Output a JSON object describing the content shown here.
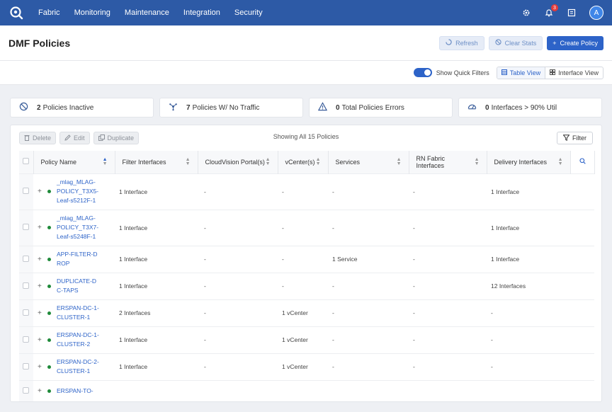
{
  "nav": {
    "items": [
      "Fabric",
      "Monitoring",
      "Maintenance",
      "Integration",
      "Security"
    ],
    "notification_count": "3",
    "avatar_initial": "A"
  },
  "header": {
    "title": "DMF Policies",
    "refresh_label": "Refresh",
    "clear_stats_label": "Clear Stats",
    "create_label": "Create Policy"
  },
  "viewbar": {
    "quick_filters_label": "Show Quick Filters",
    "table_view_label": "Table View",
    "interface_view_label": "Interface View"
  },
  "stats": [
    {
      "value": "2",
      "label": "Policies Inactive",
      "icon": "ban-icon"
    },
    {
      "value": "7",
      "label": "Policies W/ No Traffic",
      "icon": "network-icon"
    },
    {
      "value": "0",
      "label": "Total Policies Errors",
      "icon": "warning-icon"
    },
    {
      "value": "0",
      "label": "Interfaces > 90% Util",
      "icon": "gauge-icon"
    }
  ],
  "table_tools": {
    "delete_label": "Delete",
    "edit_label": "Edit",
    "duplicate_label": "Duplicate",
    "showing_text": "Showing All 15 Policies",
    "filter_label": "Filter"
  },
  "columns": [
    "Policy Name",
    "Filter Interfaces",
    "CloudVision Portal(s)",
    "vCenter(s)",
    "Services",
    "RN Fabric Interfaces",
    "Delivery Interfaces"
  ],
  "rows": [
    {
      "name": "_mlag_MLAG-POLICY_T3X5-Leaf-s5212F-1",
      "filter": "1 Interface",
      "cvp": "-",
      "vcenter": "-",
      "services": "-",
      "rn": "-",
      "delivery": "1 Interface"
    },
    {
      "name": "_mlag_MLAG-POLICY_T3X7-Leaf-s5248F-1",
      "filter": "1 Interface",
      "cvp": "-",
      "vcenter": "-",
      "services": "-",
      "rn": "-",
      "delivery": "1 Interface"
    },
    {
      "name": "APP-FILTER-DROP",
      "filter": "1 Interface",
      "cvp": "-",
      "vcenter": "-",
      "services": "1 Service",
      "rn": "-",
      "delivery": "1 Interface"
    },
    {
      "name": "DUPLICATE-DC-TAPS",
      "filter": "1 Interface",
      "cvp": "-",
      "vcenter": "-",
      "services": "-",
      "rn": "-",
      "delivery": "12 Interfaces"
    },
    {
      "name": "ERSPAN-DC-1-CLUSTER-1",
      "filter": "2 Interfaces",
      "cvp": "-",
      "vcenter": "1 vCenter",
      "services": "-",
      "rn": "-",
      "delivery": "-"
    },
    {
      "name": "ERSPAN-DC-1-CLUSTER-2",
      "filter": "1 Interface",
      "cvp": "-",
      "vcenter": "1 vCenter",
      "services": "-",
      "rn": "-",
      "delivery": "-"
    },
    {
      "name": "ERSPAN-DC-2-CLUSTER-1",
      "filter": "1 Interface",
      "cvp": "-",
      "vcenter": "1 vCenter",
      "services": "-",
      "rn": "-",
      "delivery": "-"
    },
    {
      "name": "ERSPAN-TO-",
      "filter": "",
      "cvp": "",
      "vcenter": "",
      "services": "",
      "rn": "",
      "delivery": ""
    }
  ],
  "colors": {
    "nav_bg": "#2d5aa6",
    "primary": "#2d63c8",
    "link": "#2d63c8",
    "active_dot": "#1f8a3a"
  }
}
